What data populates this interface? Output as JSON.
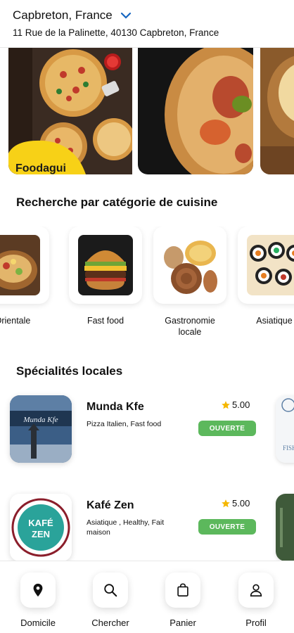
{
  "location": {
    "city": "Capbreton, France",
    "address": "11 Rue de la Palinette, 40130 Capbreton, France"
  },
  "banner": {
    "brand": "Foodagui"
  },
  "categories_section": {
    "title": "Recherche par catégorie de cuisine",
    "items": [
      {
        "label": "Orientale"
      },
      {
        "label": "Fast food"
      },
      {
        "label": "Gastronomie locale"
      },
      {
        "label": "Asiatique"
      }
    ]
  },
  "specialties_section": {
    "title": "Spécialités locales",
    "restaurants": [
      {
        "name": "Munda Kfe",
        "tags": "Pizza Italien, Fast food",
        "rating": "5.00",
        "status": "OUVERTE",
        "logo_text": "Munda Kfe"
      },
      {
        "name": "Kafé Zen",
        "tags": "Asiatique , Healthy, Fait maison",
        "rating": "5.00",
        "status": "OUVERTE",
        "logo_text_top": "KAFÉ",
        "logo_text_bottom": "ZEN"
      }
    ]
  },
  "bottom_nav": {
    "items": [
      {
        "label": "Domicile",
        "icon": "location-pin-icon"
      },
      {
        "label": "Chercher",
        "icon": "search-icon"
      },
      {
        "label": "Panier",
        "icon": "shopping-bag-icon"
      },
      {
        "label": "Profil",
        "icon": "user-icon"
      }
    ]
  },
  "colors": {
    "accent": "#1565c0",
    "open_green": "#5cb85c",
    "star": "#f5b700",
    "banner_yellow": "#f7d117"
  }
}
